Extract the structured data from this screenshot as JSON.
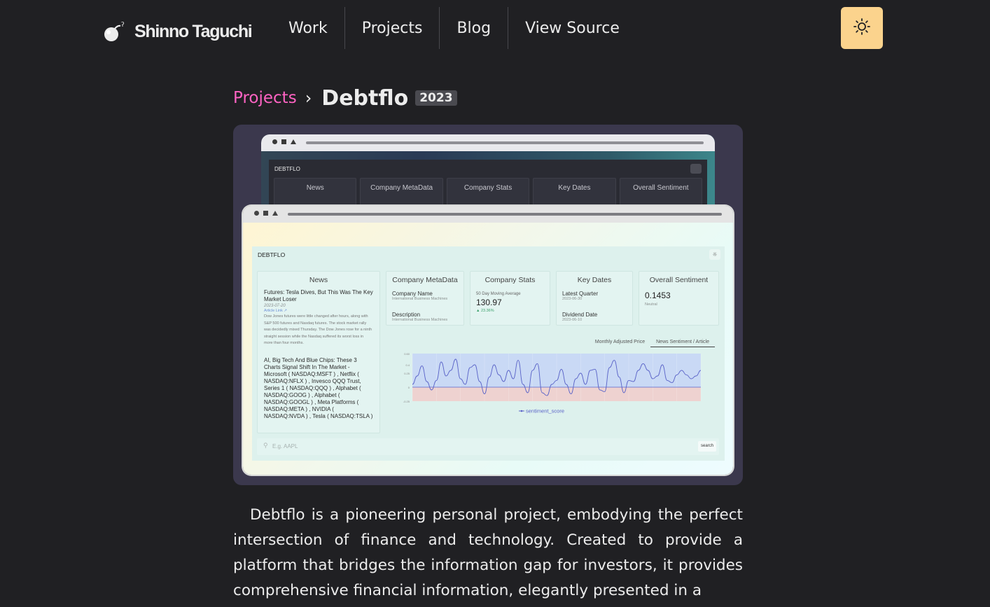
{
  "nav": {
    "site_name": "Shinno Taguchi",
    "links": [
      "Work",
      "Projects",
      "Blog",
      "View Source"
    ],
    "theme_icon": "sun-icon",
    "accent": "#fbd38d"
  },
  "breadcrumb": {
    "parent": "Projects",
    "separator": "›",
    "title": "Debtflo",
    "year": "2023",
    "link_color": "#ff63c3"
  },
  "mockup_back": {
    "brand": "DEBTFLO",
    "cards": [
      "News",
      "Company MetaData",
      "Company Stats",
      "Key Dates",
      "Overall Sentiment"
    ]
  },
  "mockup_front": {
    "brand": "DEBTFLO",
    "news": {
      "title": "News",
      "items": [
        {
          "headline": "Futures: Tesla Dives, But This Was The Key Market Loser",
          "date": "2023-07-20",
          "link": "Article Link ↗",
          "body": "Dow Jones futures were little changed after hours, along with S&P 500 futures and Nasdaq futures. The stock market rally was decidedly mixed Thursday. The Dow Jones rose for a ninth straight session while the Nasdaq suffered its worst loss in more than four months."
        },
        {
          "headline": "AI, Big Tech And Blue Chips: These 3 Charts Signal Shift In The Market - Microsoft ( NASDAQ:MSFT ) , Netflix ( NASDAQ:NFLX ) , Invesco QQQ Trust, Series 1 ( NASDAQ:QQQ ) , Alphabet ( NASDAQ:GOOG ) , Alphabet ( NASDAQ:GOOGL ) , Meta Platforms ( NASDAQ:META ) , NVIDIA ( NASDAQ:NVDA ) , Tesla ( NASDAQ:TSLA )"
        }
      ]
    },
    "meta": {
      "title": "Company MetaData",
      "name_label": "Company Name",
      "name_value": "International Business Machines",
      "desc_label": "Description",
      "desc_value": "International Business Machines"
    },
    "stats": {
      "title": "Company Stats",
      "label": "50 Day Moving Average",
      "value": "130.97",
      "change": "▲ 23.36%"
    },
    "dates": {
      "title": "Key Dates",
      "q_label": "Latest Quarter",
      "q_value": "2023-06-30",
      "d_label": "Dividend Date",
      "d_value": "2023-06-10"
    },
    "sentiment": {
      "title": "Overall Sentiment",
      "value": "0.1453",
      "label": "Neutral"
    },
    "chart_tabs": [
      "Monthly Adjusted Price",
      "News Sentiment / Article"
    ],
    "search_placeholder": "E.g. AAPL",
    "search_button": "search"
  },
  "chart_data": {
    "type": "line",
    "series": [
      {
        "name": "sentiment_score",
        "values": [
          0.05,
          0.2,
          0.38,
          0.1,
          -0.05,
          0.12,
          0.45,
          0.2,
          0.3,
          0.5,
          0.15,
          0.05,
          0.35,
          0.4,
          0.1,
          -0.12,
          0.18,
          0.4,
          0.22,
          0.1,
          0.3,
          0.15,
          0.48,
          0.05,
          -0.1,
          0.3,
          0.42,
          -0.1,
          -0.15,
          0.05,
          0.12,
          0.32,
          0.05,
          -0.12,
          0.15,
          0.25,
          0.05,
          0.3,
          0.32,
          -0.05,
          -0.08,
          0.35,
          0.48,
          0.18,
          -0.1,
          0.12,
          0.1,
          0.3,
          0.42,
          0.3,
          0.15,
          0.2,
          0.4,
          0.12,
          0.08,
          0.22,
          0.3,
          0.22,
          0.15,
          0.2,
          0.3
        ]
      }
    ],
    "ylim": [
      -0.25,
      0.6
    ],
    "tick_labels": [
      "0.60",
      "0.4",
      "0.25",
      "0",
      "-0.25"
    ],
    "legend": "bottom-center",
    "band_colors": [
      "#c9d9f5",
      "#eed2d0"
    ],
    "line_color": "#5a63c8"
  },
  "description": "Debtflo is a pioneering personal project, embodying the perfect intersection of finance and technology. Created to provide a platform that bridges the information gap for investors, it provides comprehensive financial information, elegantly presented in a"
}
